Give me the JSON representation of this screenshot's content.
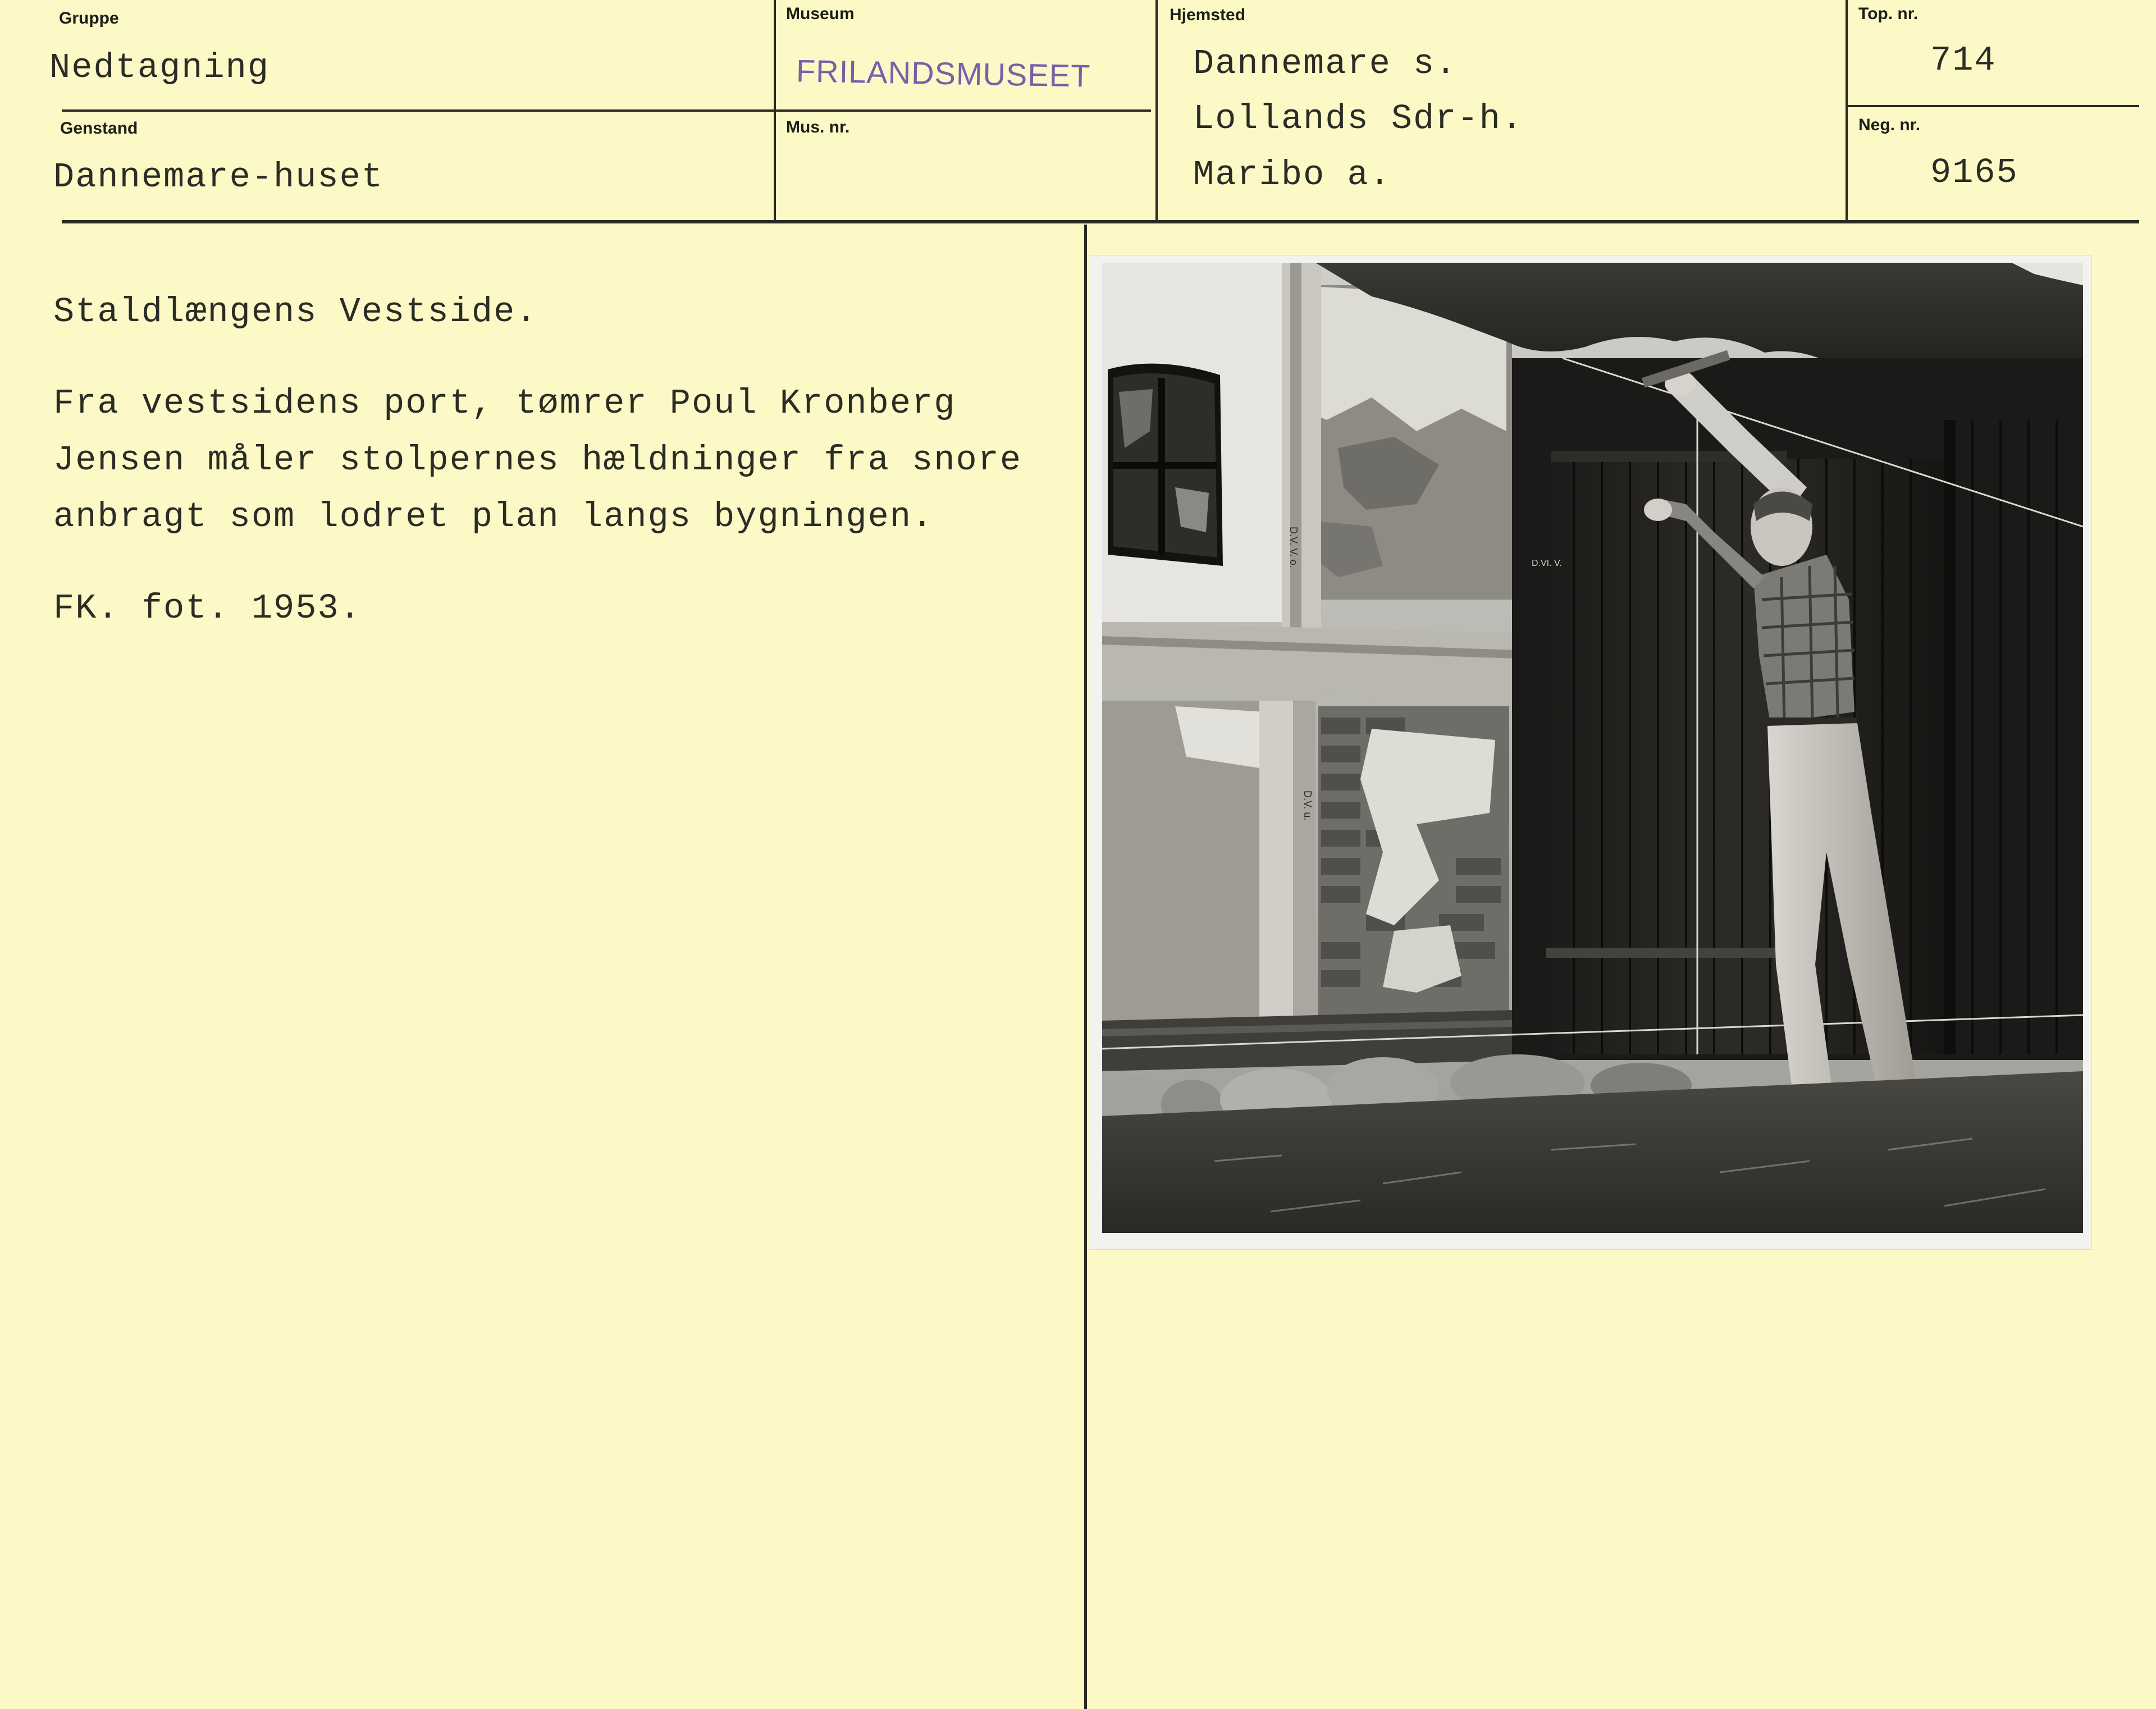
{
  "header": {
    "gruppe": {
      "label": "Gruppe",
      "value": "Nedtagning"
    },
    "museum": {
      "label": "Museum",
      "value": "FRILANDSMUSEET"
    },
    "hjemsted": {
      "label": "Hjemsted",
      "lines": [
        "Dannemare s.",
        "Lollands Sdr-h.",
        "Maribo a."
      ]
    },
    "top_nr": {
      "label": "Top. nr.",
      "value": "714"
    },
    "genstand": {
      "label": "Genstand",
      "value": "Dannemare-huset"
    },
    "mus_nr": {
      "label": "Mus. nr.",
      "value": ""
    },
    "neg_nr": {
      "label": "Neg. nr.",
      "value": "9165"
    }
  },
  "description": {
    "title": "Staldlængens Vestside.",
    "body": "Fra vestsidens port, tømrer Poul Kronberg\nJensen måler stolpernes hældninger fra snore\nanbragt som lodret plan langs bygningen.",
    "credit": "FK. fot. 1953."
  },
  "photo": {
    "wall_marks": [
      "D.V. V. o.",
      "D.V. u.",
      "D.VI. V."
    ]
  },
  "colors": {
    "card": "#fcf9c6",
    "ink": "#2c2c26",
    "stamp": "#7a5fa8"
  }
}
